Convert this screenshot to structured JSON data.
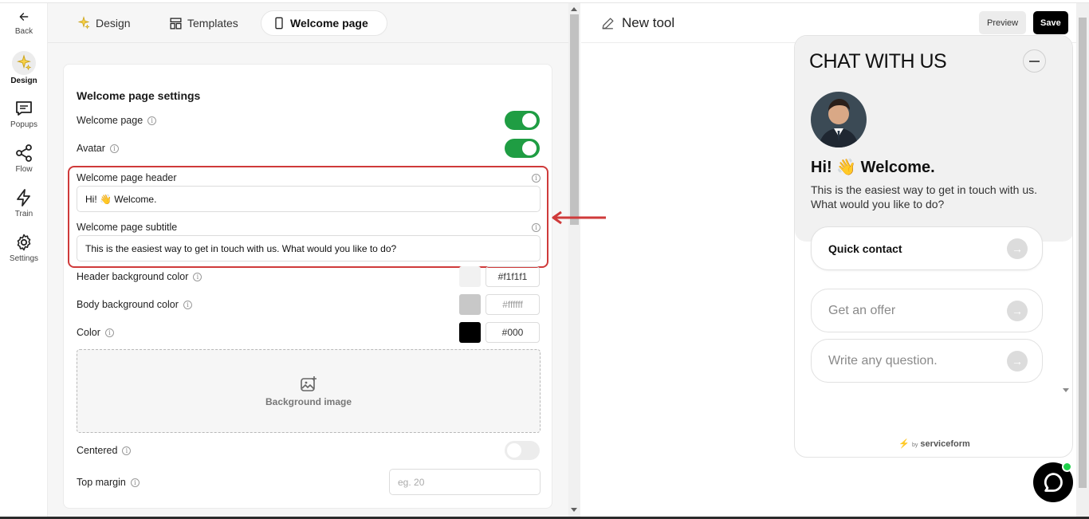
{
  "rail": {
    "back": "Back",
    "items": [
      {
        "label": "Design",
        "icon": "sparkle-icon",
        "active": true
      },
      {
        "label": "Popups",
        "icon": "chat-bubble-icon"
      },
      {
        "label": "Flow",
        "icon": "share-nodes-icon"
      },
      {
        "label": "Train",
        "icon": "lightning-icon"
      },
      {
        "label": "Settings",
        "icon": "gear-icon"
      }
    ]
  },
  "tabs": [
    {
      "label": "Design",
      "icon": "sparkle-icon"
    },
    {
      "label": "Templates",
      "icon": "template-icon"
    },
    {
      "label": "Welcome page",
      "icon": "phone-icon",
      "active": true
    }
  ],
  "settings": {
    "title": "Welcome page settings",
    "welcome_page": {
      "label": "Welcome page",
      "on": true
    },
    "avatar": {
      "label": "Avatar",
      "on": true
    },
    "header_field": {
      "label": "Welcome page header",
      "value": "Hi! 👋 Welcome."
    },
    "subtitle_field": {
      "label": "Welcome page subtitle",
      "value": "This is the easiest way to get in touch with us. What would you like to do?"
    },
    "header_bg": {
      "label": "Header background color",
      "value": "#f1f1f1"
    },
    "body_bg": {
      "label": "Body background color",
      "value": "#ffffff"
    },
    "color": {
      "label": "Color",
      "value": "#000"
    },
    "background_image": "Background image",
    "centered": {
      "label": "Centered",
      "on": false
    },
    "top_margin": {
      "label": "Top margin",
      "placeholder": "eg. 20"
    }
  },
  "preview": {
    "tool_name": "New tool",
    "preview_button": "Preview",
    "save_button": "Save"
  },
  "widget": {
    "title": "CHAT WITH US",
    "welcome": "Hi! 👋 Welcome.",
    "subtitle": "This is the easiest way to get in touch with us. What would you like to do?",
    "options": [
      "Quick contact",
      "Get an offer",
      "Write any question."
    ],
    "branding_by": "by",
    "branding_name": "serviceform"
  },
  "colors": {
    "toggle_on": "#1f9d43",
    "highlight": "#cf3a3a",
    "online": "#1fd14b"
  }
}
